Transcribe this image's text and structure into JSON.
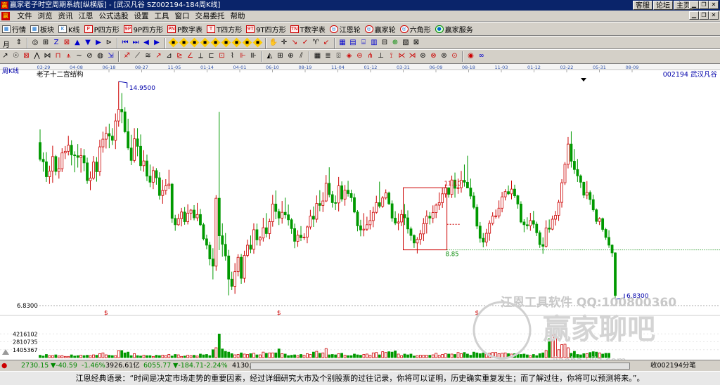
{
  "window": {
    "app_title": "赢家老子时空周期系统[纵横版]",
    "doc_title": "[武汉凡谷  SZ002194-184周K线]",
    "links": [
      "客服",
      "论坛",
      "主页"
    ]
  },
  "menu": [
    "文件",
    "浏览",
    "资讯",
    "江恩",
    "公式选股",
    "设置",
    "工具",
    "窗口",
    "交易委托",
    "帮助"
  ],
  "toolbar1": [
    {
      "label": "行情",
      "icon": "grid-icon",
      "tag": "▦"
    },
    {
      "label": "板块",
      "icon": "grid-icon",
      "tag": "▦"
    },
    {
      "label": "K线",
      "icon": "candle-icon",
      "tag": "K"
    },
    {
      "label": "P四方形",
      "icon": "p-square-icon",
      "tag": "P"
    },
    {
      "label": "9P四方形",
      "icon": "9p-square-icon",
      "tag": "9P"
    },
    {
      "label": "P数字表",
      "icon": "p-number-icon",
      "tag": "PN"
    },
    {
      "label": "T四方形",
      "icon": "t-square-icon",
      "tag": "T"
    },
    {
      "label": "9T四方形",
      "icon": "9t-square-icon",
      "tag": "9T"
    },
    {
      "label": "T数字表",
      "icon": "t-number-icon",
      "tag": "TN"
    },
    {
      "label": "江恩轮",
      "icon": "gann-wheel-icon",
      "tag": "◎"
    },
    {
      "label": "赢家轮",
      "icon": "winner-wheel-icon",
      "tag": "◎"
    },
    {
      "label": "六角形",
      "icon": "hexagon-icon",
      "tag": "◎"
    },
    {
      "label": "赢家服务",
      "icon": "service-icon",
      "tag": "●"
    }
  ],
  "period_button": "月",
  "chart_header": {
    "period_label": "周K线",
    "title": "老子十二宫结构",
    "stock_label": "002194  武汉凡谷"
  },
  "annotations": {
    "high_label": "14.9500",
    "low_label": "6.8300",
    "level_upper": "11.10",
    "level_lower": "8.85",
    "price_scale": "6.8300"
  },
  "volume_scale": [
    "4216102",
    "2810735",
    "1405367"
  ],
  "date_ticks": [
    "03-29",
    "04-08",
    "06-18",
    "08-27",
    "11-05",
    "01-14",
    "04-01",
    "06-10",
    "08-19",
    "11-04",
    "01-12",
    "03-31",
    "06-09",
    "08-18",
    "11-03",
    "01-12",
    "03-22",
    "05-31",
    "08-09"
  ],
  "watermark": {
    "software": "江恩工具软件  QQ:100800360",
    "brand": "赢家聊吧",
    "url": "liaoba.yjlz.com"
  },
  "statusbar": {
    "sh_index": "2730.15",
    "sh_change": "-40.59",
    "sh_pct": "-1.46%",
    "sh_amount": "3926.61亿",
    "sz_index": "6055.77",
    "sz_change": "-184.71",
    "sz_pct": "-2.24%",
    "sz_amount": "4130.2",
    "right_text": "收002194分笔"
  },
  "quote": "江恩经典语录：“时间是决定市场走势的重要因素，经过详细研究大市及个别股票的过往记录，你将可以证明，历史确实重复发生；而了解过往，你将可以预测将来。”。",
  "colors": {
    "up": "#cc0000",
    "down": "#009900",
    "bg": "#ffffff",
    "title_bar": "#0a246a"
  },
  "chart_data": {
    "type": "candlestick",
    "title": "老子十二宫结构",
    "x_ticks": [
      "03-29",
      "04-08",
      "06-18",
      "08-27",
      "11-05",
      "01-14",
      "04-01",
      "06-10",
      "08-19",
      "11-04",
      "01-12",
      "03-31",
      "06-09",
      "08-18",
      "11-03",
      "01-12",
      "03-22",
      "05-31",
      "08-09"
    ],
    "price_labels": {
      "high": 14.95,
      "low": 6.83
    },
    "levels": [
      11.1,
      8.85
    ],
    "ohlc": [
      [
        12.74,
        13.21,
        12.06,
        12.13
      ],
      [
        12.13,
        12.38,
        11.68,
        12.04
      ],
      [
        12.04,
        12.39,
        11.31,
        11.5
      ],
      [
        11.5,
        11.9,
        11.24,
        11.7
      ],
      [
        11.7,
        12.62,
        11.28,
        12.23
      ],
      [
        12.23,
        12.29,
        11.55,
        11.69
      ],
      [
        11.69,
        12.2,
        11.43,
        11.79
      ],
      [
        11.79,
        12.53,
        11.67,
        12.36
      ],
      [
        12.36,
        12.61,
        12.14,
        12.42
      ],
      [
        12.42,
        12.98,
        12.27,
        12.64
      ],
      [
        12.64,
        12.82,
        11.91,
        12.29
      ],
      [
        12.29,
        12.42,
        11.66,
        12.26
      ],
      [
        12.26,
        12.68,
        11.83,
        12.2
      ],
      [
        12.2,
        12.53,
        11.65,
        12.26
      ],
      [
        12.26,
        12.5,
        11.7,
        12.0
      ],
      [
        12.0,
        12.19,
        11.24,
        11.36
      ],
      [
        11.36,
        11.69,
        11.01,
        11.45
      ],
      [
        11.45,
        12.25,
        11.39,
        12.03
      ],
      [
        12.03,
        12.21,
        11.32,
        11.68
      ],
      [
        11.68,
        12.84,
        11.53,
        12.58
      ],
      [
        12.58,
        13.13,
        12.37,
        12.86
      ],
      [
        12.86,
        13.31,
        12.52,
        13.06
      ],
      [
        13.06,
        13.42,
        12.53,
        12.97
      ],
      [
        12.97,
        13.26,
        12.65,
        12.82
      ],
      [
        12.82,
        13.79,
        12.5,
        13.52
      ],
      [
        13.52,
        14.95,
        13.31,
        13.94
      ],
      [
        13.94,
        14.53,
        13.44,
        13.85
      ],
      [
        13.85,
        14.02,
        13.08,
        13.13
      ],
      [
        13.13,
        13.6,
        12.47,
        12.54
      ],
      [
        12.54,
        13.02,
        11.92,
        12.09
      ],
      [
        12.09,
        13.26,
        12.01,
        12.87
      ],
      [
        12.87,
        13.26,
        12.24,
        12.6
      ],
      [
        12.6,
        13.03,
        11.72,
        11.9
      ],
      [
        11.9,
        12.46,
        11.68,
        12.07
      ],
      [
        12.07,
        12.3,
        11.34,
        11.52
      ],
      [
        11.52,
        11.94,
        11.12,
        11.3
      ],
      [
        11.3,
        11.87,
        11.05,
        11.72
      ],
      [
        11.72,
        11.81,
        11.21,
        11.46
      ],
      [
        11.46,
        11.66,
        10.67,
        10.82
      ],
      [
        10.82,
        11.39,
        10.52,
        11.0
      ],
      [
        11.0,
        11.41,
        10.85,
        11.17
      ],
      [
        11.17,
        11.75,
        11.05,
        11.23
      ],
      [
        11.23,
        11.27,
        9.83,
        9.99
      ],
      [
        9.99,
        10.12,
        9.54,
        9.76
      ],
      [
        9.76,
        10.15,
        9.72,
        9.98
      ],
      [
        9.98,
        10.37,
        9.7,
        10.22
      ],
      [
        10.22,
        10.4,
        9.76,
        9.87
      ],
      [
        9.87,
        10.5,
        9.77,
        10.18
      ],
      [
        10.18,
        10.33,
        9.93,
        10.29
      ],
      [
        10.29,
        10.47,
        9.92,
        10.01
      ],
      [
        10.01,
        10.55,
        9.89,
        10.13
      ],
      [
        10.13,
        10.33,
        9.71,
        9.76
      ],
      [
        9.76,
        9.83,
        9.19,
        9.25
      ],
      [
        9.25,
        9.4,
        8.87,
        9.02
      ],
      [
        9.02,
        9.14,
        8.29,
        8.52
      ],
      [
        8.52,
        8.91,
        7.78,
        8.26
      ],
      [
        8.26,
        10.83,
        8.09,
        10.72
      ],
      [
        10.72,
        13.85,
        8.84,
        9.36
      ],
      [
        9.36,
        9.81,
        8.6,
        9.05
      ],
      [
        9.05,
        9.46,
        8.46,
        8.63
      ],
      [
        8.63,
        8.85,
        7.2,
        7.79
      ],
      [
        7.79,
        8.06,
        7.39,
        7.53
      ],
      [
        7.53,
        8.37,
        7.26,
        8.06
      ],
      [
        8.06,
        8.69,
        7.89,
        8.58
      ],
      [
        8.58,
        8.7,
        7.62,
        7.82
      ],
      [
        7.82,
        8.82,
        7.66,
        8.65
      ],
      [
        8.65,
        9.22,
        8.58,
        9.02
      ],
      [
        9.02,
        9.37,
        8.73,
        8.87
      ],
      [
        8.87,
        9.81,
        8.71,
        9.58
      ],
      [
        9.58,
        9.8,
        9.01,
        9.21
      ],
      [
        9.21,
        9.35,
        9.0,
        9.28
      ],
      [
        9.28,
        10.01,
        9.15,
        9.65
      ],
      [
        9.65,
        10.18,
        9.3,
        9.44
      ],
      [
        9.44,
        9.98,
        9.24,
        9.87
      ],
      [
        9.87,
        10.84,
        9.69,
        10.51
      ],
      [
        10.51,
        11.0,
        9.96,
        10.24
      ],
      [
        10.24,
        10.34,
        9.75,
        10.0
      ],
      [
        10.0,
        10.62,
        9.8,
        10.21
      ],
      [
        10.21,
        10.74,
        9.98,
        10.12
      ],
      [
        10.12,
        10.49,
        9.73,
        9.94
      ],
      [
        9.94,
        10.0,
        9.43,
        9.62
      ],
      [
        9.62,
        9.8,
        8.91,
        9.16
      ],
      [
        9.16,
        9.56,
        8.96,
        9.38
      ],
      [
        9.38,
        9.71,
        9.17,
        9.29
      ],
      [
        9.29,
        9.45,
        9.21,
        9.31
      ],
      [
        9.31,
        9.73,
        9.09,
        9.68
      ],
      [
        9.68,
        10.3,
        9.59,
        10.07
      ],
      [
        10.07,
        10.42,
        9.68,
        9.96
      ],
      [
        9.96,
        10.82,
        9.84,
        10.53
      ],
      [
        10.53,
        11.01,
        10.25,
        10.46
      ],
      [
        10.46,
        10.94,
        10.22,
        10.62
      ],
      [
        10.62,
        11.56,
        10.58,
        11.26
      ],
      [
        11.26,
        11.84,
        10.75,
        10.85
      ],
      [
        10.85,
        10.98,
        10.38,
        10.56
      ],
      [
        10.56,
        10.82,
        10.29,
        10.55
      ],
      [
        10.55,
        11.49,
        10.24,
        11.17
      ],
      [
        11.17,
        11.33,
        10.6,
        10.69
      ],
      [
        10.69,
        11.2,
        10.45,
        11.01
      ],
      [
        11.01,
        11.35,
        10.78,
        10.89
      ],
      [
        10.89,
        11.03,
        10.59,
        10.74
      ],
      [
        10.74,
        10.89,
        10.18,
        10.22
      ],
      [
        10.22,
        10.29,
        9.52,
        9.72
      ],
      [
        9.72,
        9.94,
        9.34,
        9.57
      ],
      [
        9.57,
        10.18,
        9.34,
        9.6
      ],
      [
        9.6,
        10.05,
        9.53,
        9.76
      ],
      [
        9.76,
        10.29,
        9.59,
        9.91
      ],
      [
        9.91,
        10.41,
        9.67,
        10.21
      ],
      [
        10.21,
        10.81,
        10.16,
        10.56
      ],
      [
        10.56,
        11.32,
        10.36,
        10.43
      ],
      [
        10.43,
        10.8,
        10.37,
        10.73
      ],
      [
        10.73,
        11.04,
        10.67,
        10.91
      ],
      [
        10.91,
        10.96,
        10.47,
        10.52
      ],
      [
        10.52,
        10.64,
        9.87,
        10.0
      ],
      [
        10.0,
        10.25,
        9.75,
        9.82
      ],
      [
        9.82,
        10.17,
        9.56,
        9.86
      ],
      [
        9.86,
        10.3,
        9.71,
        10.13
      ],
      [
        10.13,
        10.51,
        9.75,
        10.01
      ],
      [
        10.01,
        10.28,
        9.44,
        9.61
      ],
      [
        9.61,
        9.69,
        9.18,
        9.37
      ],
      [
        9.37,
        9.41,
        8.92,
        9.1
      ],
      [
        9.1,
        9.31,
        8.72,
        9.23
      ],
      [
        9.23,
        9.57,
        9.03,
        9.43
      ],
      [
        9.43,
        10.0,
        9.17,
        9.8
      ],
      [
        9.8,
        10.28,
        9.44,
        10.07
      ],
      [
        10.07,
        10.22,
        9.77,
        10.0
      ],
      [
        10.0,
        10.46,
        9.82,
        10.2
      ],
      [
        10.2,
        10.53,
        10.0,
        10.47
      ],
      [
        10.47,
        10.93,
        10.29,
        10.56
      ],
      [
        10.56,
        11.09,
        10.37,
        10.88
      ],
      [
        10.88,
        11.22,
        10.74,
        11.1
      ],
      [
        11.1,
        11.11,
        10.74,
        10.86
      ],
      [
        10.86,
        11.54,
        10.73,
        11.38
      ],
      [
        11.38,
        11.65,
        10.74,
        11.08
      ],
      [
        11.08,
        11.43,
        10.88,
        11.1
      ],
      [
        11.1,
        11.71,
        10.92,
        11.37
      ],
      [
        11.37,
        11.94,
        11.14,
        11.3
      ],
      [
        11.3,
        12.26,
        11.11,
        11.09
      ],
      [
        11.09,
        11.43,
        10.69,
        10.8
      ],
      [
        10.8,
        10.94,
        10.32,
        10.39
      ],
      [
        10.39,
        10.5,
        9.6,
        9.71
      ],
      [
        9.71,
        9.86,
        9.11,
        9.27
      ],
      [
        9.27,
        9.46,
        8.94,
        9.13
      ],
      [
        9.13,
        9.61,
        8.98,
        9.45
      ],
      [
        9.45,
        9.92,
        9.18,
        9.81
      ],
      [
        9.81,
        10.21,
        9.74,
        10.07
      ],
      [
        10.07,
        10.31,
        9.98,
        10.08
      ],
      [
        10.08,
        10.64,
        9.99,
        10.36
      ],
      [
        10.36,
        10.95,
        10.21,
        10.77
      ],
      [
        10.77,
        11.05,
        10.64,
        10.96
      ],
      [
        10.96,
        11.18,
        10.83,
        10.88
      ],
      [
        10.88,
        11.36,
        10.68,
        11.05
      ],
      [
        11.05,
        11.21,
        10.73,
        10.81
      ],
      [
        10.81,
        10.85,
        10.34,
        10.51
      ],
      [
        10.51,
        10.61,
        9.81,
        9.86
      ],
      [
        9.86,
        9.96,
        9.49,
        9.76
      ],
      [
        9.76,
        10.03,
        9.59,
        9.72
      ],
      [
        9.72,
        10.19,
        9.54,
        9.91
      ],
      [
        9.91,
        10.26,
        9.63,
        9.78
      ],
      [
        9.78,
        9.87,
        9.35,
        9.47
      ],
      [
        9.47,
        9.55,
        8.92,
        9.04
      ],
      [
        9.04,
        9.3,
        8.71,
        8.98
      ],
      [
        8.98,
        9.92,
        8.93,
        9.64
      ],
      [
        9.64,
        9.95,
        9.47,
        9.6
      ],
      [
        9.6,
        10.09,
        9.56,
        9.96
      ],
      [
        9.96,
        10.26,
        9.73,
        10.1
      ],
      [
        10.1,
        10.66,
        9.9,
        10.57
      ],
      [
        10.57,
        11.41,
        10.38,
        11.28
      ],
      [
        11.28,
        12.03,
        11.2,
        11.95
      ],
      [
        11.95,
        12.94,
        11.8,
        12.68
      ],
      [
        12.68,
        13.14,
        11.83,
        12.06
      ],
      [
        12.06,
        12.5,
        11.6,
        11.76
      ],
      [
        11.76,
        12.14,
        11.31,
        11.53
      ],
      [
        11.53,
        11.58,
        11.09,
        11.3
      ],
      [
        11.3,
        11.32,
        10.72,
        10.83
      ],
      [
        10.83,
        11.34,
        10.69,
        10.93
      ],
      [
        10.93,
        11.0,
        10.48,
        10.67
      ],
      [
        10.67,
        10.85,
        10.23,
        10.3
      ],
      [
        10.3,
        10.35,
        9.78,
        9.88
      ],
      [
        9.88,
        10.03,
        9.75,
        9.98
      ],
      [
        9.98,
        10.02,
        9.51,
        9.59
      ],
      [
        9.59,
        9.65,
        9.21,
        9.3
      ],
      [
        9.3,
        9.56,
        8.92,
        9.02
      ],
      [
        9.02,
        9.05,
        8.59,
        8.74
      ],
      [
        8.74,
        8.76,
        7.06,
        7.2
      ]
    ],
    "volume": [
      0.06,
      0.04,
      0.08,
      0.05,
      0.05,
      0.07,
      0.04,
      0.05,
      0.03,
      0.03,
      0.07,
      0.04,
      0.05,
      0.06,
      0.05,
      0.06,
      0.05,
      0.07,
      0.06,
      0.1,
      0.12,
      0.07,
      0.06,
      0.05,
      0.05,
      0.18,
      0.18,
      0.12,
      0.14,
      0.05,
      0.1,
      0.05,
      0.04,
      0.06,
      0.05,
      0.05,
      0.03,
      0.06,
      0.05,
      0.06,
      0.05,
      0.08,
      0.04,
      0.08,
      0.07,
      0.03,
      0.04,
      0.06,
      0.05,
      0.06,
      0.04,
      0.09,
      0.07,
      0.08,
      0.05,
      0.2,
      0.25,
      0.6,
      0.22,
      0.16,
      0.14,
      0.1,
      0.07,
      0.08,
      0.12,
      0.09,
      0.08,
      0.1,
      0.11,
      0.07,
      0.07,
      0.14,
      0.11,
      0.12,
      0.12,
      0.12,
      0.22,
      0.1,
      0.09,
      0.05,
      0.06,
      0.07,
      0.05,
      0.08,
      0.06,
      0.1,
      0.08,
      0.14,
      0.16,
      0.11,
      0.12,
      0.23,
      0.07,
      0.08,
      0.07,
      0.1,
      0.11,
      0.06,
      0.05,
      0.05,
      0.09,
      0.07,
      0.06,
      0.08,
      0.09,
      0.06,
      0.12,
      0.13,
      0.07,
      0.15,
      0.13,
      0.15,
      0.14,
      0.17,
      0.09,
      0.05,
      0.09,
      0.07,
      0.09,
      0.04,
      0.05,
      0.06,
      0.06,
      0.06,
      0.06,
      0.07,
      0.11,
      0.06,
      0.08,
      0.1,
      0.09,
      0.09,
      0.08,
      0.13,
      0.1,
      0.13,
      0.09,
      0.06,
      0.14,
      0.12,
      0.1,
      0.12,
      0.1,
      0.11,
      0.13,
      0.13,
      0.1,
      0.11,
      0.12,
      0.1,
      0.09,
      0.1,
      0.1,
      0.08,
      0.09,
      0.07,
      0.05,
      0.08,
      0.05,
      0.1,
      0.12,
      0.18,
      0.48,
      0.57,
      0.6,
      0.2,
      0.33,
      0.34,
      0.25,
      0.11,
      0.16,
      0.08,
      0.07,
      0.1,
      0.1,
      0.13,
      0.15,
      0.14,
      0.12,
      0.09,
      0.11,
      0.11
    ],
    "volume_max": 7000000
  }
}
